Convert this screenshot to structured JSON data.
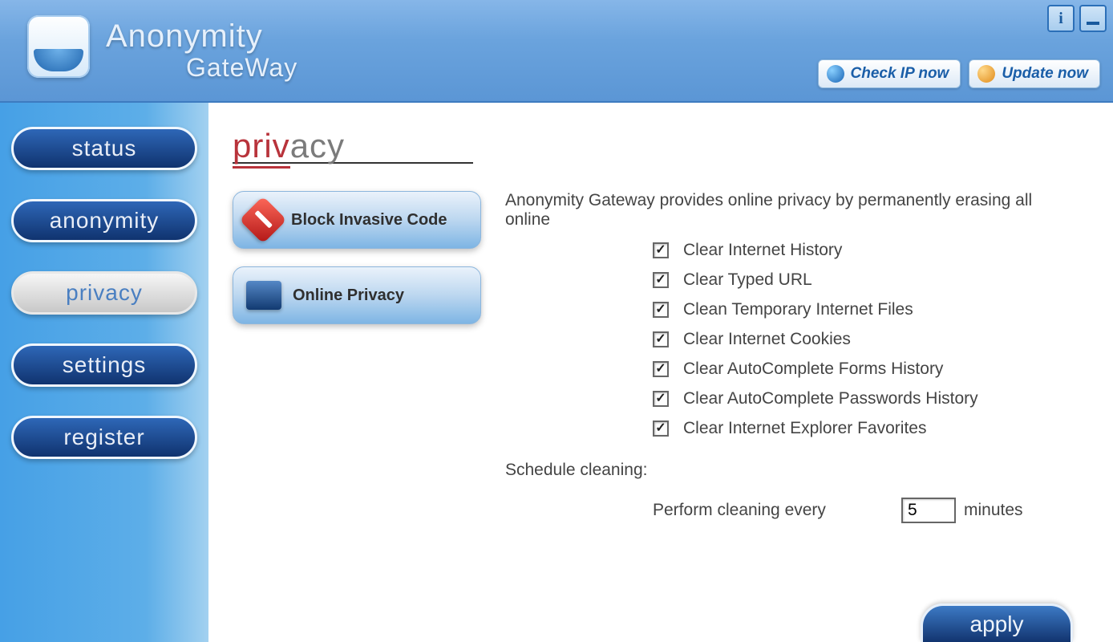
{
  "app": {
    "title_line1": "Anonymity",
    "title_line2": "GateWay"
  },
  "header": {
    "check_ip": "Check IP now",
    "update": "Update now"
  },
  "nav": {
    "status": "status",
    "anonymity": "anonymity",
    "privacy": "privacy",
    "settings": "settings",
    "register": "register"
  },
  "page": {
    "heading_accent": "priv",
    "heading_rest": "acy"
  },
  "subnav": {
    "block_invasive": "Block Invasive Code",
    "online_privacy": "Online Privacy"
  },
  "privacy": {
    "intro": "Anonymity Gateway provides online privacy by permanently erasing all online",
    "options": [
      "Clear Internet History",
      "Clear Typed URL",
      "Clean Temporary Internet Files",
      "Clear Internet Cookies",
      "Clear AutoComplete Forms History",
      "Clear AutoComplete Passwords History",
      "Clear Internet Explorer Favorites"
    ],
    "schedule_label": "Schedule cleaning:",
    "perform_prefix": "Perform cleaning every",
    "perform_suffix": "minutes",
    "interval_value": "5"
  },
  "actions": {
    "apply": "apply"
  }
}
